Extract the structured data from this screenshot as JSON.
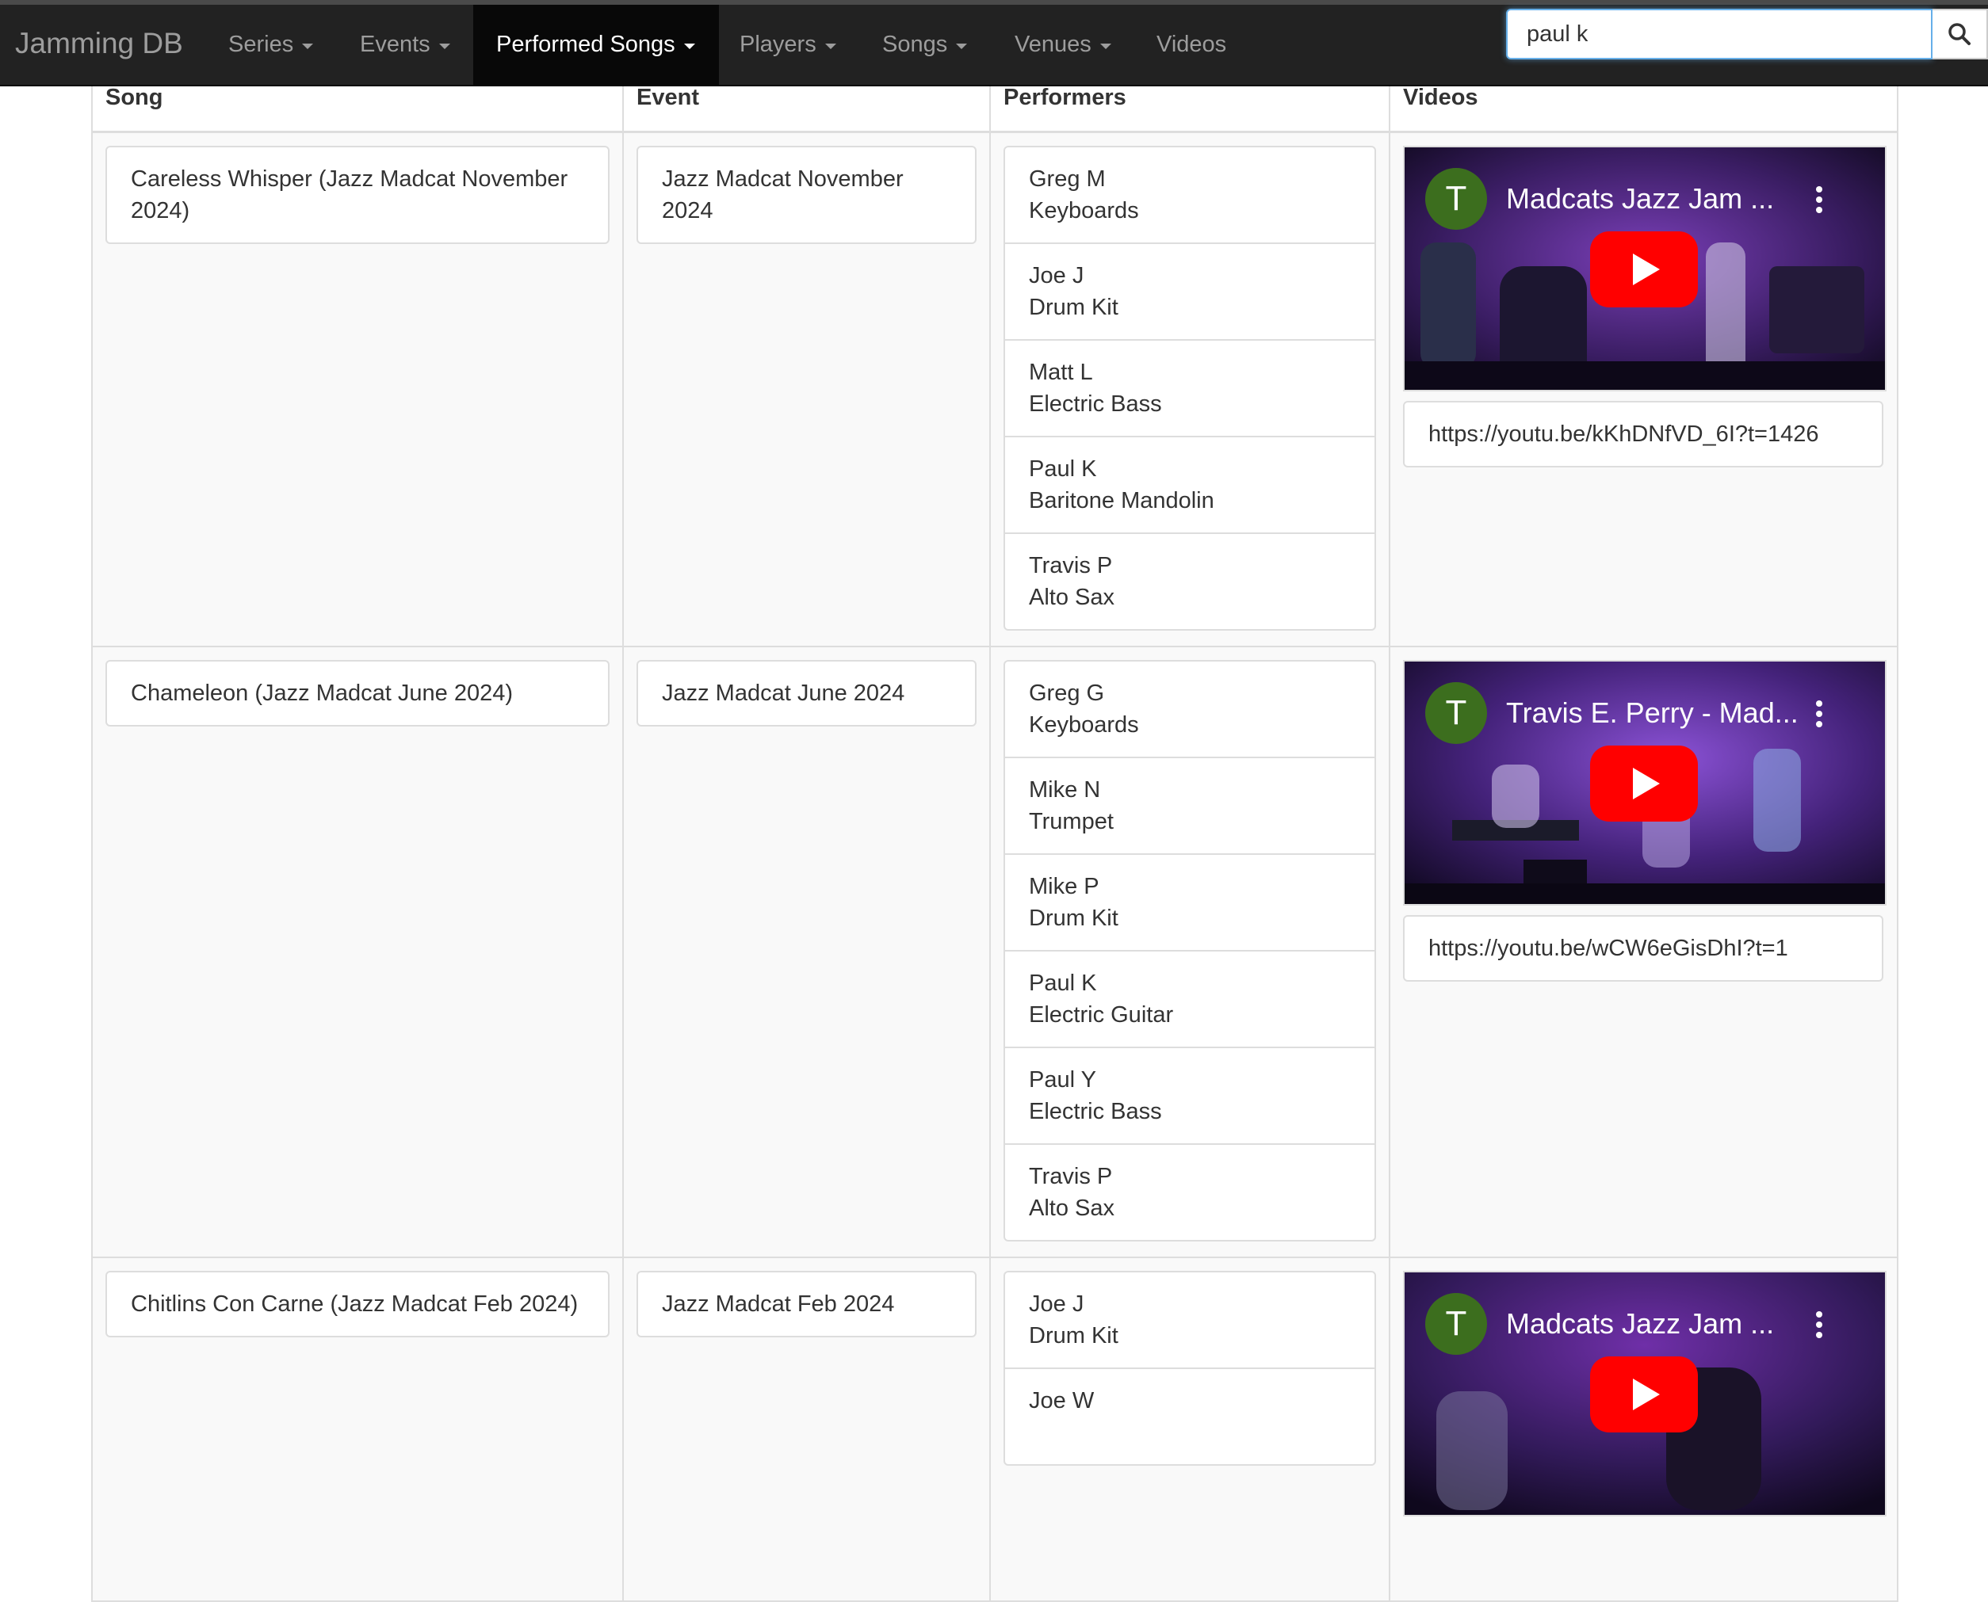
{
  "nav": {
    "brand": "Jamming DB",
    "items": [
      {
        "label": "Series",
        "dropdown": true
      },
      {
        "label": "Events",
        "dropdown": true
      },
      {
        "label": "Performed Songs",
        "dropdown": true,
        "active": true
      },
      {
        "label": "Players",
        "dropdown": true
      },
      {
        "label": "Songs",
        "dropdown": true
      },
      {
        "label": "Venues",
        "dropdown": true
      },
      {
        "label": "Videos",
        "dropdown": false
      }
    ],
    "search_value": "paul k",
    "search_icon": "search-icon"
  },
  "table": {
    "headers": [
      "Song",
      "Event",
      "Performers",
      "Videos"
    ],
    "rows": [
      {
        "song": "Careless Whisper (Jazz Madcat November 2024)",
        "event": "Jazz Madcat November 2024",
        "performers": [
          {
            "name": "Greg M",
            "instrument": "Keyboards"
          },
          {
            "name": "Joe J",
            "instrument": "Drum Kit"
          },
          {
            "name": "Matt L",
            "instrument": "Electric Bass"
          },
          {
            "name": "Paul K",
            "instrument": "Baritone Mandolin"
          },
          {
            "name": "Travis P",
            "instrument": "Alto Sax"
          }
        ],
        "video": {
          "channel_initial": "T",
          "title": "Madcats Jazz Jam ...",
          "url": "https://youtu.be/kKhDNfVD_6I?t=1426"
        }
      },
      {
        "song": "Chameleon (Jazz Madcat June 2024)",
        "event": "Jazz Madcat June 2024",
        "performers": [
          {
            "name": "Greg G",
            "instrument": "Keyboards"
          },
          {
            "name": "Mike N",
            "instrument": "Trumpet"
          },
          {
            "name": "Mike P",
            "instrument": "Drum Kit"
          },
          {
            "name": "Paul K",
            "instrument": "Electric Guitar"
          },
          {
            "name": "Paul Y",
            "instrument": "Electric Bass"
          },
          {
            "name": "Travis P",
            "instrument": "Alto Sax"
          }
        ],
        "video": {
          "channel_initial": "T",
          "title": "Travis E. Perry - Mad...",
          "url": "https://youtu.be/wCW6eGisDhI?t=1"
        }
      },
      {
        "song": "Chitlins Con Carne (Jazz Madcat Feb 2024)",
        "event": "Jazz Madcat Feb 2024",
        "performers": [
          {
            "name": "Joe J",
            "instrument": "Drum Kit"
          },
          {
            "name": "Joe W",
            "instrument": ""
          }
        ],
        "video": {
          "channel_initial": "T",
          "title": "Madcats Jazz Jam ...",
          "url": ""
        }
      }
    ]
  },
  "colors": {
    "navbar_bg": "#222222",
    "nav_active_bg": "#080808",
    "nav_text": "#9d9d9d",
    "cell_bg": "#f9f9f9",
    "border": "#dddddd",
    "avatar": "#3c6e1e",
    "play_button": "#ff0000"
  }
}
